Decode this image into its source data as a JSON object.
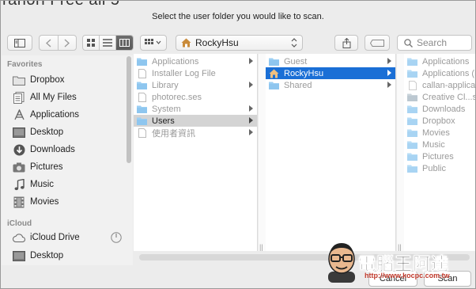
{
  "window": {
    "clipped_title": "ranorl Free all 5",
    "prompt": "Select the user folder you would like to scan."
  },
  "toolbar": {
    "path_label": "RockyHsu",
    "search_placeholder": "Search"
  },
  "sidebar": {
    "favorites_header": "Favorites",
    "favorites": [
      {
        "label": "Dropbox",
        "icon": "folder-icon"
      },
      {
        "label": "All My Files",
        "icon": "all-files-icon"
      },
      {
        "label": "Applications",
        "icon": "applications-icon"
      },
      {
        "label": "Desktop",
        "icon": "desktop-icon"
      },
      {
        "label": "Downloads",
        "icon": "downloads-icon"
      },
      {
        "label": "Pictures",
        "icon": "camera-icon"
      },
      {
        "label": "Music",
        "icon": "music-icon"
      },
      {
        "label": "Movies",
        "icon": "movies-icon"
      }
    ],
    "icloud_header": "iCloud",
    "icloud": [
      {
        "label": "iCloud Drive",
        "icon": "cloud-icon"
      },
      {
        "label": "Desktop",
        "icon": "desktop-icon"
      }
    ]
  },
  "column1": [
    {
      "label": "Applications",
      "type": "folder",
      "arrow": true,
      "state": "dim"
    },
    {
      "label": "Installer Log File",
      "type": "file",
      "arrow": false,
      "state": "dim"
    },
    {
      "label": "Library",
      "type": "folder",
      "arrow": true,
      "state": "dim"
    },
    {
      "label": "photorec.ses",
      "type": "file",
      "arrow": false,
      "state": "dim"
    },
    {
      "label": "System",
      "type": "folder",
      "arrow": true,
      "state": "dim"
    },
    {
      "label": "Users",
      "type": "folder",
      "arrow": true,
      "state": "selected-gray"
    },
    {
      "label": "使用者資訊",
      "type": "file",
      "arrow": true,
      "state": "dim"
    }
  ],
  "column2": [
    {
      "label": "Guest",
      "type": "folder",
      "arrow": true,
      "state": "dim"
    },
    {
      "label": "RockyHsu",
      "type": "home",
      "arrow": true,
      "state": "selected-blue"
    },
    {
      "label": "Shared",
      "type": "folder",
      "arrow": true,
      "state": "dim"
    }
  ],
  "column3": [
    {
      "label": "Applications",
      "type": "folder"
    },
    {
      "label": "Applications (P",
      "type": "folder"
    },
    {
      "label": "callan-applica",
      "type": "file"
    },
    {
      "label": "Creative Cl...s",
      "type": "folder"
    },
    {
      "label": "Downloads",
      "type": "folder"
    },
    {
      "label": "Dropbox",
      "type": "folder"
    },
    {
      "label": "Movies",
      "type": "folder"
    },
    {
      "label": "Music",
      "type": "folder"
    },
    {
      "label": "Pictures",
      "type": "folder"
    },
    {
      "label": "Public",
      "type": "folder"
    }
  ],
  "buttons": {
    "cancel": "Cancel",
    "scan": "Scan"
  },
  "watermark": {
    "text": "電腦王阿達",
    "url": "http://www.kocpc.com.tw"
  },
  "colors": {
    "selection_blue": "#1a6fd6",
    "selection_gray": "#d4d4d4",
    "folder_blue": "#8ec6ef"
  }
}
